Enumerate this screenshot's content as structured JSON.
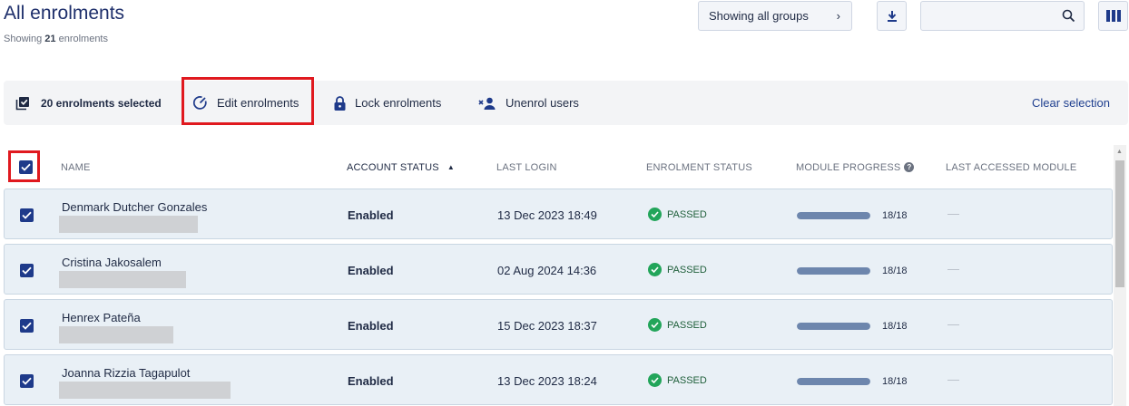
{
  "header": {
    "title": "All enrolments",
    "subtitle_prefix": "Showing",
    "count": "21",
    "subtitle_suffix": "enrolments"
  },
  "toolbar": {
    "groups_label": "Showing all groups",
    "search_placeholder": "",
    "search_value": ""
  },
  "selection_bar": {
    "selected_text": "20 enrolments selected",
    "edit_label": "Edit enrolments",
    "lock_label": "Lock enrolments",
    "unenrol_label": "Unenrol users",
    "clear_label": "Clear selection"
  },
  "columns": {
    "name": "NAME",
    "account_status": "ACCOUNT STATUS",
    "last_login": "LAST LOGIN",
    "enrolment_status": "ENROLMENT STATUS",
    "module_progress": "MODULE PROGRESS",
    "last_accessed": "LAST ACCESSED MODULE"
  },
  "rows": [
    {
      "name": "Denmark Dutcher Gonzales",
      "account_status": "Enabled",
      "last_login": "13 Dec 2023 18:49",
      "enrolment_status": "PASSED",
      "progress": "18/18",
      "progress_fraction": 1.0,
      "last_accessed": "—"
    },
    {
      "name": "Cristina Jakosalem",
      "account_status": "Enabled",
      "last_login": "02 Aug 2024 14:36",
      "enrolment_status": "PASSED",
      "progress": "18/18",
      "progress_fraction": 1.0,
      "last_accessed": "—"
    },
    {
      "name": "Henrex Pateña",
      "account_status": "Enabled",
      "last_login": "15 Dec 2023 18:37",
      "enrolment_status": "PASSED",
      "progress": "18/18",
      "progress_fraction": 1.0,
      "last_accessed": "—"
    },
    {
      "name": "Joanna Rizzia Tagapulot",
      "account_status": "Enabled",
      "last_login": "13 Dec 2023 18:24",
      "enrolment_status": "PASSED",
      "progress": "18/18",
      "progress_fraction": 1.0,
      "last_accessed": "—"
    }
  ],
  "colors": {
    "accent": "#1e3a8a",
    "highlight": "#e0191f",
    "passed": "#22a55a",
    "progress_fill": "#6d86ad"
  },
  "icons": {
    "groups_chevron": "chevron-right-icon",
    "download": "download-icon",
    "search": "search-icon",
    "columns": "columns-icon",
    "selected": "selected-stack-icon",
    "edit": "edit-gauge-icon",
    "lock": "lock-icon",
    "unenrol": "unenrol-user-icon"
  }
}
